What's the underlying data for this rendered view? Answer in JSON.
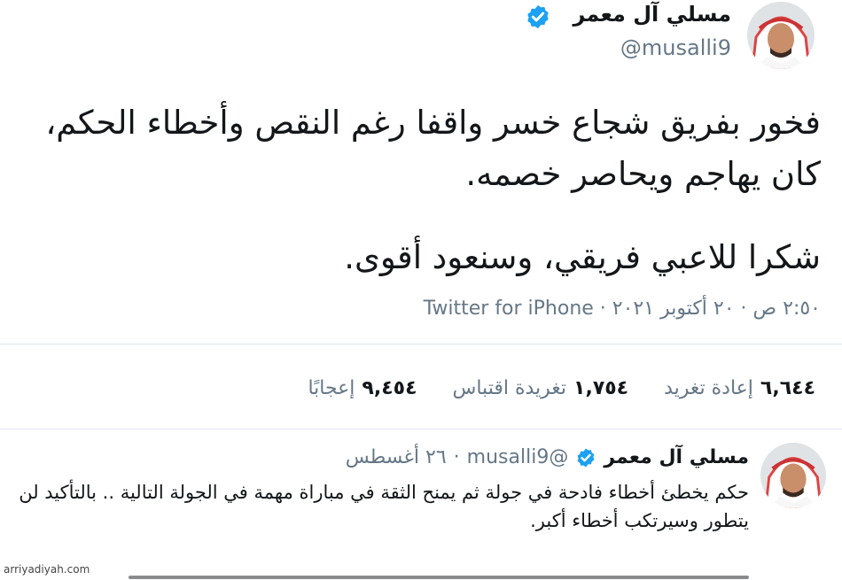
{
  "tweet": {
    "author_name": "مسلي آل معمر",
    "handle": "@musalli9",
    "text_line1": "فخور بفريق شجاع خسر واقفا رغم النقص وأخطاء الحكم،",
    "text_line2": "كان يهاجم ويحاصر خصمه.",
    "text_line3": "شكرا للاعبي فريقي، وسنعود أقوى.",
    "meta": "٢:٥٠ ص · ٢٠ أكتوبر ٢٠٢١ · Twitter for iPhone"
  },
  "stats": {
    "retweets_count": "٦,٦٤٤",
    "retweets_label": "إعادة تغريد",
    "quotes_count": "١,٧٥٤",
    "quotes_label": "تغريدة اقتباس",
    "likes_count": "٩,٤٥٤",
    "likes_label": "إعجابًا"
  },
  "reply": {
    "author_name": "مسلي آل معمر",
    "handle": "@musalli9",
    "separator": "·",
    "date": "٢٦ أغسطس",
    "text": "حكم يخطئ أخطاء فادحة في جولة ثم يمنح الثقة في مباراة مهمة في الجولة التالية .. بالتأكيد لن يتطور وسيرتكب أخطاء أكبر."
  },
  "watermark": "arriyadiyah.com",
  "colors": {
    "verified": "#1da1f2",
    "secondary_text": "#657786",
    "divider": "#e1e8ed"
  },
  "icons": {
    "verified": "verified-badge-icon",
    "avatar": "profile-photo"
  }
}
